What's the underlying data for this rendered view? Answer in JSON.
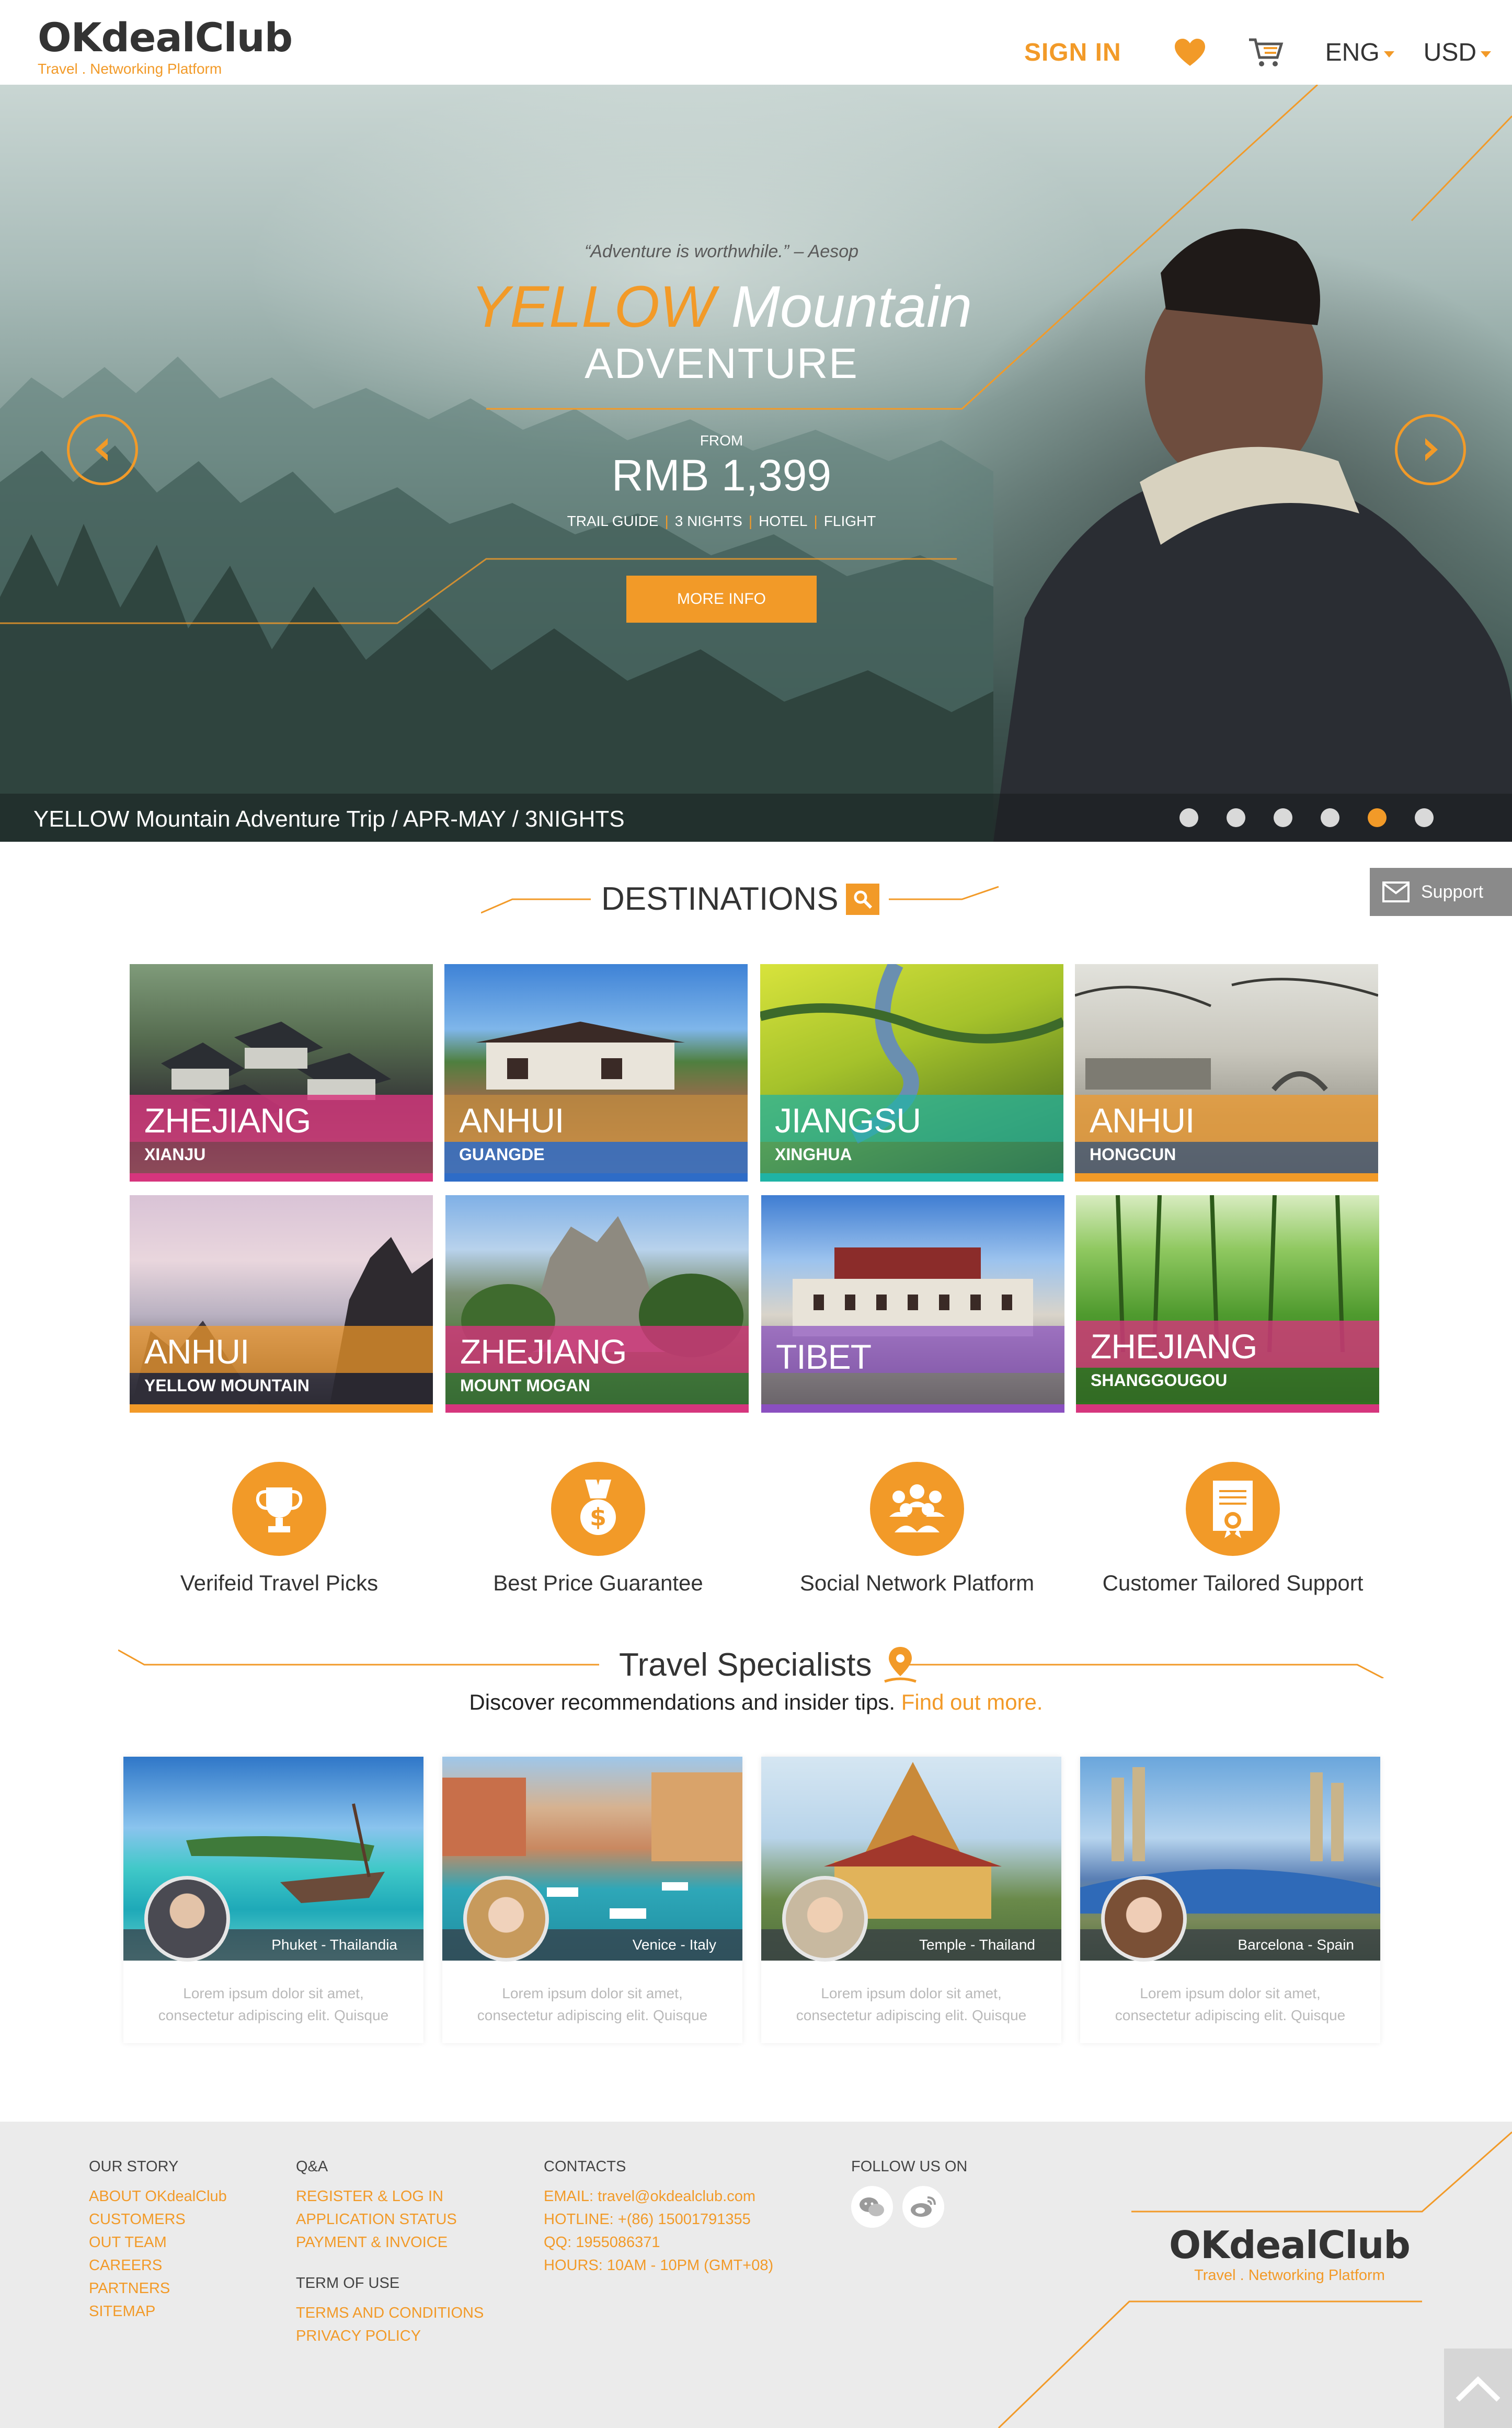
{
  "header": {
    "logo": "OKdealClub",
    "tagline": "Travel . Networking Platform",
    "sign_in": "SIGN IN",
    "language": "ENG",
    "currency": "USD",
    "icons": [
      "heart-icon",
      "cart-icon"
    ]
  },
  "hero": {
    "quote": "“Adventure is worthwhile.” – Aesop",
    "title_highlight": "YELLOW",
    "title_rest": " Mountain",
    "subtitle": "ADVENTURE",
    "from_label": "FROM",
    "price": "RMB 1,399",
    "features": [
      "TRAIL GUIDE",
      "3 NIGHTS",
      "HOTEL",
      "FLIGHT"
    ],
    "button": "MORE INFO",
    "caption": "YELLOW Mountain Adventure Trip  / APR-MAY / 3NIGHTS",
    "slide_count": 6,
    "active_slide": 5
  },
  "support": {
    "label": "Support"
  },
  "destinations": {
    "title": "DESTINATIONS",
    "items": [
      {
        "name": "ZHEJIANG",
        "sub": "XIANJU",
        "color": "#d6357d"
      },
      {
        "name": "ANHUI",
        "sub": "GUANGDE",
        "color": "#2e6cc7"
      },
      {
        "name": "JIANGSU",
        "sub": "XINGHUA",
        "color": "#1fb3a5"
      },
      {
        "name": "ANHUI",
        "sub": "HONGCUN",
        "color": "#f29a28"
      },
      {
        "name": "ANHUI",
        "sub": "YELLOW MOUNTAIN",
        "color": "#f29a28"
      },
      {
        "name": "ZHEJIANG",
        "sub": "MOUNT MOGAN",
        "color": "#d6357d"
      },
      {
        "name": "TIBET",
        "sub": "",
        "color": "#8a4fc0"
      },
      {
        "name": "ZHEJIANG",
        "sub": "SHANGGOUGOU",
        "color": "#d6357d"
      }
    ]
  },
  "features": [
    {
      "label": "Verifeid Travel Picks",
      "icon": "trophy-icon"
    },
    {
      "label": "Best Price Guarantee",
      "icon": "medal-icon"
    },
    {
      "label": "Social Network Platform",
      "icon": "people-icon"
    },
    {
      "label": "Customer Tailored Support",
      "icon": "certificate-icon"
    }
  ],
  "specialists": {
    "title": "Travel Specialists",
    "subtitle": "Discover recommendations and insider tips.",
    "link": "Find out more.",
    "cards": [
      {
        "location": "Phuket - Thailandia",
        "text1": "Lorem ipsum dolor sit amet,",
        "text2": "consectetur adipiscing elit. Quisque"
      },
      {
        "location": "Venice - Italy",
        "text1": "Lorem ipsum dolor sit amet,",
        "text2": "consectetur adipiscing elit. Quisque"
      },
      {
        "location": "Temple - Thailand",
        "text1": "Lorem ipsum dolor sit amet,",
        "text2": "consectetur adipiscing elit. Quisque"
      },
      {
        "location": "Barcelona - Spain",
        "text1": "Lorem ipsum dolor sit amet,",
        "text2": "consectetur adipiscing elit. Quisque"
      }
    ]
  },
  "footer": {
    "our_story": {
      "title": "OUR STORY",
      "links": [
        "ABOUT OKdealClub",
        "CUSTOMERS",
        "OUT TEAM",
        "CAREERS",
        "PARTNERS",
        "SITEMAP"
      ]
    },
    "qa": {
      "title": "Q&A",
      "links": [
        "REGISTER & LOG IN",
        "APPLICATION STATUS",
        "PAYMENT & INVOICE"
      ]
    },
    "terms": {
      "title": "TERM OF USE",
      "links": [
        "TERMS AND CONDITIONS",
        "PRIVACY POLICY"
      ]
    },
    "contacts": {
      "title": "CONTACTS",
      "lines": [
        "EMAIL: travel@okdealclub.com",
        "HOTLINE: +(86) 15001791355",
        "QQ: 1955086371",
        "HOURS: 10AM - 10PM (GMT+08)"
      ]
    },
    "follow": {
      "title": "FOLLOW US ON",
      "icons": [
        "wechat-icon",
        "weibo-icon"
      ]
    },
    "logo": "OKdealClub",
    "tagline": "Travel . Networking Platform"
  },
  "colors": {
    "accent": "#f29a28",
    "footer_bg": "#ebebeb",
    "text": "#333333"
  }
}
